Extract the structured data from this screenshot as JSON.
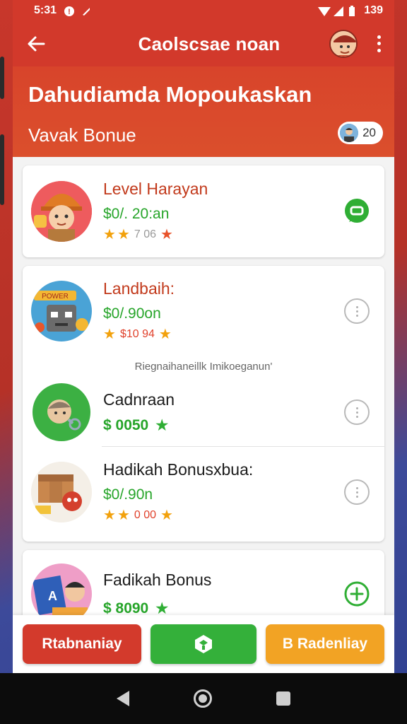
{
  "status_bar": {
    "time": "5:31",
    "battery": "139"
  },
  "app_bar": {
    "title": "Caolscsae noan"
  },
  "header": {
    "title": "Dahudiamda Mopoukaskan",
    "subtitle": "Vavak Bonue",
    "badge_count": "20"
  },
  "cards": {
    "level": {
      "title": "Level Harayan",
      "amount": "$0/. 20:an",
      "rating": "7 06",
      "action_icon": "chat-icon"
    },
    "landbaih": {
      "title": "Landbaih:",
      "amount": "$0/.90on",
      "rating": "$10 94",
      "section_label": "Riegnaihaneillk Imikoeganun'",
      "items": [
        {
          "title": "Cadnraan",
          "amount": "$ 0050"
        },
        {
          "title": "Hadikah Bonusxbua:",
          "amount": "$0/.90n",
          "rating": "0 00"
        }
      ]
    },
    "fadikah": {
      "title": "Fadikah Bonus",
      "amount": "$ 8090"
    }
  },
  "bottom_buttons": {
    "left": "Rtabnaniay",
    "right": "B Radenliay"
  },
  "colors": {
    "primary": "#d2392b",
    "green": "#34b03a",
    "orange": "#f2a324"
  }
}
